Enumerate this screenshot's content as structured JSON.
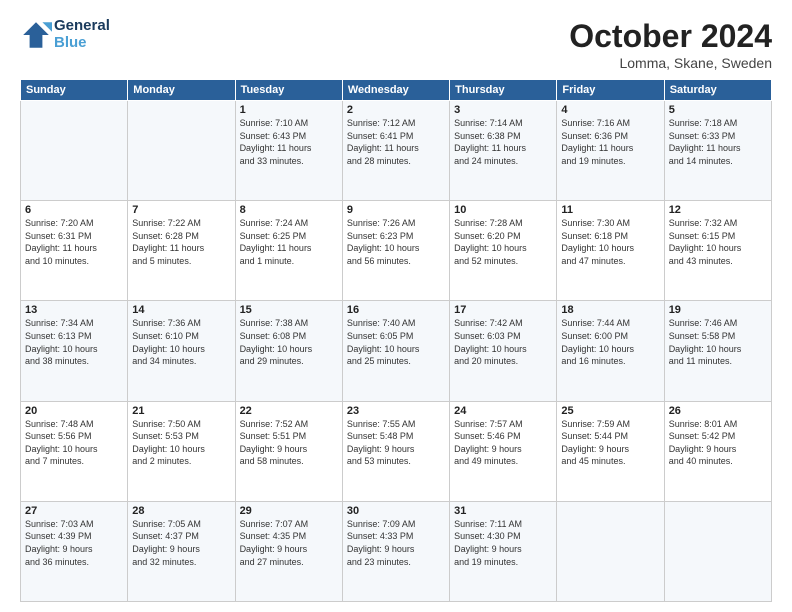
{
  "header": {
    "logo_line1": "General",
    "logo_line2": "Blue",
    "month": "October 2024",
    "location": "Lomma, Skane, Sweden"
  },
  "weekdays": [
    "Sunday",
    "Monday",
    "Tuesday",
    "Wednesday",
    "Thursday",
    "Friday",
    "Saturday"
  ],
  "weeks": [
    [
      {
        "day": "",
        "info": ""
      },
      {
        "day": "",
        "info": ""
      },
      {
        "day": "1",
        "info": "Sunrise: 7:10 AM\nSunset: 6:43 PM\nDaylight: 11 hours\nand 33 minutes."
      },
      {
        "day": "2",
        "info": "Sunrise: 7:12 AM\nSunset: 6:41 PM\nDaylight: 11 hours\nand 28 minutes."
      },
      {
        "day": "3",
        "info": "Sunrise: 7:14 AM\nSunset: 6:38 PM\nDaylight: 11 hours\nand 24 minutes."
      },
      {
        "day": "4",
        "info": "Sunrise: 7:16 AM\nSunset: 6:36 PM\nDaylight: 11 hours\nand 19 minutes."
      },
      {
        "day": "5",
        "info": "Sunrise: 7:18 AM\nSunset: 6:33 PM\nDaylight: 11 hours\nand 14 minutes."
      }
    ],
    [
      {
        "day": "6",
        "info": "Sunrise: 7:20 AM\nSunset: 6:31 PM\nDaylight: 11 hours\nand 10 minutes."
      },
      {
        "day": "7",
        "info": "Sunrise: 7:22 AM\nSunset: 6:28 PM\nDaylight: 11 hours\nand 5 minutes."
      },
      {
        "day": "8",
        "info": "Sunrise: 7:24 AM\nSunset: 6:25 PM\nDaylight: 11 hours\nand 1 minute."
      },
      {
        "day": "9",
        "info": "Sunrise: 7:26 AM\nSunset: 6:23 PM\nDaylight: 10 hours\nand 56 minutes."
      },
      {
        "day": "10",
        "info": "Sunrise: 7:28 AM\nSunset: 6:20 PM\nDaylight: 10 hours\nand 52 minutes."
      },
      {
        "day": "11",
        "info": "Sunrise: 7:30 AM\nSunset: 6:18 PM\nDaylight: 10 hours\nand 47 minutes."
      },
      {
        "day": "12",
        "info": "Sunrise: 7:32 AM\nSunset: 6:15 PM\nDaylight: 10 hours\nand 43 minutes."
      }
    ],
    [
      {
        "day": "13",
        "info": "Sunrise: 7:34 AM\nSunset: 6:13 PM\nDaylight: 10 hours\nand 38 minutes."
      },
      {
        "day": "14",
        "info": "Sunrise: 7:36 AM\nSunset: 6:10 PM\nDaylight: 10 hours\nand 34 minutes."
      },
      {
        "day": "15",
        "info": "Sunrise: 7:38 AM\nSunset: 6:08 PM\nDaylight: 10 hours\nand 29 minutes."
      },
      {
        "day": "16",
        "info": "Sunrise: 7:40 AM\nSunset: 6:05 PM\nDaylight: 10 hours\nand 25 minutes."
      },
      {
        "day": "17",
        "info": "Sunrise: 7:42 AM\nSunset: 6:03 PM\nDaylight: 10 hours\nand 20 minutes."
      },
      {
        "day": "18",
        "info": "Sunrise: 7:44 AM\nSunset: 6:00 PM\nDaylight: 10 hours\nand 16 minutes."
      },
      {
        "day": "19",
        "info": "Sunrise: 7:46 AM\nSunset: 5:58 PM\nDaylight: 10 hours\nand 11 minutes."
      }
    ],
    [
      {
        "day": "20",
        "info": "Sunrise: 7:48 AM\nSunset: 5:56 PM\nDaylight: 10 hours\nand 7 minutes."
      },
      {
        "day": "21",
        "info": "Sunrise: 7:50 AM\nSunset: 5:53 PM\nDaylight: 10 hours\nand 2 minutes."
      },
      {
        "day": "22",
        "info": "Sunrise: 7:52 AM\nSunset: 5:51 PM\nDaylight: 9 hours\nand 58 minutes."
      },
      {
        "day": "23",
        "info": "Sunrise: 7:55 AM\nSunset: 5:48 PM\nDaylight: 9 hours\nand 53 minutes."
      },
      {
        "day": "24",
        "info": "Sunrise: 7:57 AM\nSunset: 5:46 PM\nDaylight: 9 hours\nand 49 minutes."
      },
      {
        "day": "25",
        "info": "Sunrise: 7:59 AM\nSunset: 5:44 PM\nDaylight: 9 hours\nand 45 minutes."
      },
      {
        "day": "26",
        "info": "Sunrise: 8:01 AM\nSunset: 5:42 PM\nDaylight: 9 hours\nand 40 minutes."
      }
    ],
    [
      {
        "day": "27",
        "info": "Sunrise: 7:03 AM\nSunset: 4:39 PM\nDaylight: 9 hours\nand 36 minutes."
      },
      {
        "day": "28",
        "info": "Sunrise: 7:05 AM\nSunset: 4:37 PM\nDaylight: 9 hours\nand 32 minutes."
      },
      {
        "day": "29",
        "info": "Sunrise: 7:07 AM\nSunset: 4:35 PM\nDaylight: 9 hours\nand 27 minutes."
      },
      {
        "day": "30",
        "info": "Sunrise: 7:09 AM\nSunset: 4:33 PM\nDaylight: 9 hours\nand 23 minutes."
      },
      {
        "day": "31",
        "info": "Sunrise: 7:11 AM\nSunset: 4:30 PM\nDaylight: 9 hours\nand 19 minutes."
      },
      {
        "day": "",
        "info": ""
      },
      {
        "day": "",
        "info": ""
      }
    ]
  ]
}
